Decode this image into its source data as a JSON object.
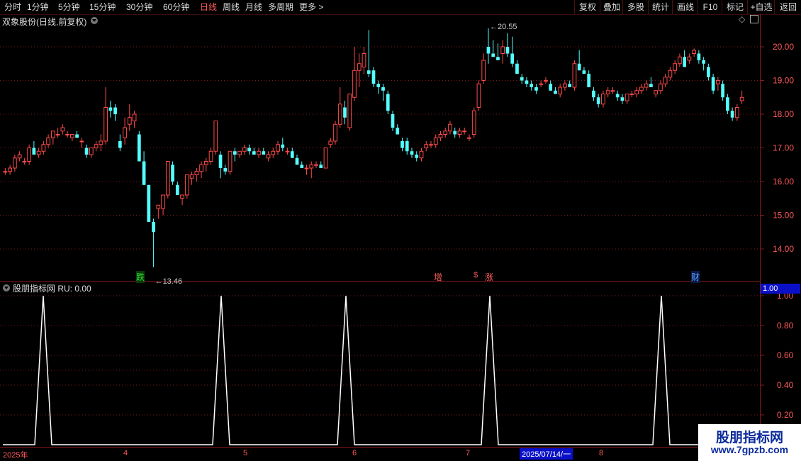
{
  "toolbar": {
    "periods": [
      "分时",
      "1分钟",
      "5分钟",
      "15分钟",
      "30分钟",
      "60分钟",
      "日线",
      "周线",
      "月线",
      "多周期",
      "更多 >"
    ],
    "active_period": "日线",
    "tools": [
      "复权",
      "叠加",
      "多股",
      "统计",
      "画线",
      "F10",
      "标记",
      "+自选",
      "返回"
    ]
  },
  "main_chart": {
    "title": "双象股份(日线,前复权)",
    "y_ticks": [
      "20.00",
      "19.00",
      "18.00",
      "17.00",
      "16.00",
      "15.00",
      "14.00"
    ],
    "y_values": [
      20,
      19,
      18,
      17,
      16,
      15,
      14
    ],
    "high_label": "20.55",
    "low_label": "13.46",
    "markers": [
      {
        "text": "跌",
        "color": "#33dd33"
      },
      {
        "text": "增",
        "color": "#ff5a5a"
      },
      {
        "text": "$",
        "color": "#ff5a5a"
      },
      {
        "text": "涨",
        "color": "#ff5a5a"
      },
      {
        "text": "财",
        "color": "#5aa0ff"
      }
    ]
  },
  "indicator": {
    "title": "股朋指标网 RU: 0.00",
    "current_value": "1.00",
    "y_ticks": [
      "1.00",
      "0.80",
      "0.60",
      "0.40",
      "0.20"
    ],
    "y_values": [
      1.0,
      0.8,
      0.6,
      0.4,
      0.2
    ]
  },
  "date_axis": {
    "labels": [
      "2025年",
      "4",
      "5",
      "6",
      "7",
      "8"
    ],
    "selected_date": "2025/07/14/一"
  },
  "watermark": {
    "line1": "股朋指标网",
    "line2": "www.7gpzb.com"
  },
  "colors": {
    "up": "#ff4a4a",
    "down": "#54ffff",
    "grid": "#7a1a1a",
    "axis": "#8a1a1a",
    "indicator_line": "#ffffff"
  },
  "chart_data": [
    {
      "type": "candlestick",
      "title": "双象股份(日线,前复权)",
      "ylim": [
        13.4,
        20.6
      ],
      "ohlc": [
        [
          16.3,
          16.4,
          16.2,
          16.3
        ],
        [
          16.3,
          16.5,
          16.2,
          16.4
        ],
        [
          16.4,
          16.8,
          16.3,
          16.7
        ],
        [
          16.7,
          16.9,
          16.6,
          16.8
        ],
        [
          16.6,
          16.7,
          16.5,
          16.6
        ],
        [
          16.6,
          17.1,
          16.5,
          17.0
        ],
        [
          17.0,
          17.2,
          16.9,
          16.8
        ],
        [
          16.8,
          17.0,
          16.7,
          16.9
        ],
        [
          16.9,
          17.2,
          16.8,
          17.1
        ],
        [
          17.1,
          17.4,
          17.0,
          17.3
        ],
        [
          17.3,
          17.5,
          17.1,
          17.5
        ],
        [
          17.4,
          17.6,
          17.3,
          17.4
        ],
        [
          17.5,
          17.7,
          17.4,
          17.6
        ],
        [
          17.4,
          17.5,
          17.3,
          17.4
        ],
        [
          17.3,
          17.4,
          17.2,
          17.4
        ],
        [
          17.4,
          17.5,
          17.3,
          17.3
        ],
        [
          17.2,
          17.3,
          17.0,
          17.2
        ],
        [
          17.0,
          17.1,
          16.7,
          16.8
        ],
        [
          16.8,
          17.0,
          16.7,
          17.0
        ],
        [
          17.0,
          17.2,
          16.9,
          17.1
        ],
        [
          17.1,
          17.4,
          16.9,
          17.2
        ],
        [
          17.2,
          18.8,
          17.1,
          18.2
        ],
        [
          18.2,
          18.4,
          17.9,
          18.1
        ],
        [
          18.2,
          18.3,
          17.8,
          18.0
        ],
        [
          17.2,
          17.4,
          16.9,
          17.0
        ],
        [
          17.3,
          17.9,
          17.1,
          17.6
        ],
        [
          17.7,
          18.3,
          17.5,
          17.9
        ],
        [
          17.8,
          18.1,
          17.6,
          18.0
        ],
        [
          17.4,
          17.5,
          16.9,
          16.6
        ],
        [
          16.6,
          16.9,
          15.9,
          15.9
        ],
        [
          15.9,
          15.9,
          14.8,
          14.8
        ],
        [
          14.8,
          14.9,
          13.46,
          14.5
        ],
        [
          15.2,
          15.2,
          14.9,
          15.3
        ],
        [
          15.2,
          15.5,
          15.0,
          15.6
        ],
        [
          15.6,
          16.6,
          15.5,
          16.6
        ],
        [
          16.5,
          16.6,
          15.9,
          16.0
        ],
        [
          15.9,
          16.0,
          15.6,
          15.6
        ],
        [
          15.5,
          15.6,
          15.3,
          15.6
        ],
        [
          15.6,
          16.2,
          15.5,
          16.2
        ],
        [
          16.1,
          16.3,
          15.9,
          16.2
        ],
        [
          16.2,
          16.4,
          16.0,
          16.3
        ],
        [
          16.3,
          16.6,
          16.1,
          16.5
        ],
        [
          16.5,
          16.7,
          16.3,
          16.6
        ],
        [
          16.6,
          17.0,
          16.5,
          16.9
        ],
        [
          16.9,
          17.8,
          16.8,
          17.8
        ],
        [
          16.8,
          16.9,
          16.1,
          16.4
        ],
        [
          16.4,
          16.5,
          16.2,
          16.3
        ],
        [
          16.3,
          16.9,
          16.2,
          16.9
        ],
        [
          16.9,
          17.0,
          16.6,
          16.8
        ],
        [
          16.8,
          16.9,
          16.7,
          16.9
        ],
        [
          16.9,
          17.1,
          16.8,
          17.0
        ],
        [
          17.0,
          17.1,
          16.8,
          16.9
        ],
        [
          16.9,
          17.0,
          16.8,
          16.8
        ],
        [
          16.8,
          17.0,
          16.7,
          16.9
        ],
        [
          16.9,
          17.0,
          16.8,
          16.8
        ],
        [
          16.7,
          16.9,
          16.6,
          16.8
        ],
        [
          16.8,
          17.0,
          16.7,
          16.9
        ],
        [
          16.9,
          17.2,
          16.8,
          17.1
        ],
        [
          17.1,
          17.3,
          16.9,
          17.0
        ],
        [
          16.9,
          17.0,
          16.8,
          16.9
        ],
        [
          16.9,
          17.0,
          16.7,
          16.7
        ],
        [
          16.7,
          16.8,
          16.5,
          16.5
        ],
        [
          16.5,
          16.6,
          16.4,
          16.4
        ],
        [
          16.4,
          16.5,
          16.2,
          16.4
        ],
        [
          16.4,
          16.6,
          16.1,
          16.5
        ],
        [
          16.5,
          16.6,
          16.4,
          16.5
        ],
        [
          16.5,
          16.6,
          16.4,
          16.4
        ],
        [
          16.4,
          17.0,
          16.4,
          17.0
        ],
        [
          17.1,
          17.3,
          17.0,
          17.2
        ],
        [
          17.2,
          17.8,
          17.1,
          17.7
        ],
        [
          17.7,
          18.8,
          17.6,
          18.3
        ],
        [
          18.2,
          18.4,
          17.7,
          17.9
        ],
        [
          17.6,
          18.6,
          17.5,
          18.6
        ],
        [
          18.5,
          20.0,
          18.4,
          19.3
        ],
        [
          19.3,
          19.8,
          18.8,
          19.5
        ],
        [
          19.4,
          20.0,
          19.2,
          19.8
        ],
        [
          19.3,
          20.5,
          19.1,
          19.2
        ],
        [
          19.3,
          19.4,
          18.8,
          18.9
        ],
        [
          18.9,
          19.0,
          18.6,
          18.8
        ],
        [
          18.8,
          18.9,
          18.4,
          18.7
        ],
        [
          18.6,
          18.7,
          18.0,
          18.1
        ],
        [
          18.0,
          18.1,
          17.5,
          17.6
        ],
        [
          17.6,
          17.7,
          17.4,
          17.4
        ],
        [
          17.2,
          17.3,
          16.9,
          17.0
        ],
        [
          17.2,
          17.3,
          16.8,
          16.9
        ],
        [
          16.9,
          17.0,
          16.7,
          16.8
        ],
        [
          16.8,
          16.9,
          16.6,
          16.7
        ],
        [
          16.7,
          17.0,
          16.6,
          16.9
        ],
        [
          17.0,
          17.2,
          16.9,
          17.1
        ],
        [
          17.1,
          17.2,
          17.0,
          17.1
        ],
        [
          17.1,
          17.4,
          17.0,
          17.3
        ],
        [
          17.3,
          17.5,
          17.2,
          17.4
        ],
        [
          17.4,
          17.6,
          17.3,
          17.5
        ],
        [
          17.5,
          17.8,
          17.4,
          17.7
        ],
        [
          17.5,
          17.6,
          17.3,
          17.4
        ],
        [
          17.4,
          17.6,
          17.3,
          17.5
        ],
        [
          17.5,
          17.6,
          17.4,
          17.5
        ],
        [
          17.3,
          17.4,
          17.2,
          17.3
        ],
        [
          17.4,
          18.2,
          17.3,
          18.1
        ],
        [
          18.2,
          19.0,
          18.1,
          18.9
        ],
        [
          19.0,
          19.8,
          18.9,
          19.6
        ],
        [
          20.0,
          20.55,
          19.5,
          19.8
        ],
        [
          19.8,
          20.2,
          19.7,
          19.7
        ],
        [
          19.7,
          20.1,
          19.6,
          19.6
        ],
        [
          19.8,
          20.2,
          19.5,
          20.0
        ],
        [
          20.0,
          20.4,
          19.7,
          19.8
        ],
        [
          19.8,
          20.3,
          19.4,
          19.5
        ],
        [
          19.5,
          19.6,
          19.2,
          19.2
        ],
        [
          19.1,
          19.2,
          18.9,
          19.0
        ],
        [
          19.0,
          19.1,
          18.8,
          18.9
        ],
        [
          18.9,
          19.0,
          18.7,
          18.8
        ],
        [
          18.8,
          18.9,
          18.6,
          18.7
        ],
        [
          18.9,
          19.0,
          18.8,
          18.9
        ],
        [
          19.0,
          19.1,
          18.9,
          19.0
        ],
        [
          18.9,
          19.0,
          18.7,
          18.7
        ],
        [
          18.7,
          18.8,
          18.6,
          18.6
        ],
        [
          18.6,
          18.9,
          18.5,
          18.8
        ],
        [
          18.8,
          19.0,
          18.7,
          18.9
        ],
        [
          18.9,
          19.0,
          18.8,
          18.8
        ],
        [
          18.8,
          19.6,
          18.7,
          19.5
        ],
        [
          19.5,
          19.9,
          19.4,
          19.3
        ],
        [
          19.3,
          19.4,
          19.2,
          19.2
        ],
        [
          19.2,
          19.3,
          19.0,
          18.8
        ],
        [
          18.7,
          18.8,
          18.4,
          18.5
        ],
        [
          18.5,
          18.6,
          18.2,
          18.3
        ],
        [
          18.3,
          18.7,
          18.2,
          18.6
        ],
        [
          18.6,
          18.8,
          18.5,
          18.7
        ],
        [
          18.7,
          18.8,
          18.6,
          18.7
        ],
        [
          18.6,
          18.7,
          18.4,
          18.5
        ],
        [
          18.5,
          18.6,
          18.3,
          18.4
        ],
        [
          18.4,
          18.5,
          18.3,
          18.6
        ],
        [
          18.6,
          18.7,
          18.5,
          18.6
        ],
        [
          18.6,
          18.8,
          18.5,
          18.7
        ],
        [
          18.7,
          18.9,
          18.6,
          18.8
        ],
        [
          18.8,
          19.0,
          18.7,
          18.9
        ],
        [
          18.9,
          19.1,
          18.8,
          18.8
        ],
        [
          18.6,
          18.7,
          18.5,
          18.7
        ],
        [
          18.7,
          19.0,
          18.6,
          18.9
        ],
        [
          18.9,
          19.2,
          18.8,
          19.1
        ],
        [
          19.1,
          19.4,
          19.0,
          19.3
        ],
        [
          19.3,
          19.6,
          19.2,
          19.5
        ],
        [
          19.5,
          19.8,
          19.4,
          19.7
        ],
        [
          19.7,
          19.9,
          19.6,
          19.4
        ],
        [
          19.6,
          19.8,
          19.5,
          19.7
        ],
        [
          19.8,
          19.95,
          19.7,
          19.9
        ],
        [
          19.8,
          19.9,
          19.5,
          19.6
        ],
        [
          19.6,
          19.7,
          19.3,
          19.5
        ],
        [
          19.4,
          19.5,
          19.0,
          19.1
        ],
        [
          19.1,
          19.2,
          18.6,
          18.7
        ],
        [
          18.9,
          19.1,
          18.7,
          19.0
        ],
        [
          18.9,
          19.0,
          18.4,
          18.5
        ],
        [
          18.5,
          18.6,
          18.0,
          18.1
        ],
        [
          18.1,
          18.2,
          17.8,
          17.9
        ],
        [
          17.9,
          18.3,
          17.8,
          18.2
        ],
        [
          18.4,
          18.7,
          18.3,
          18.5
        ]
      ]
    },
    {
      "type": "line",
      "series": [
        {
          "name": "RU",
          "values": [
            0,
            0,
            0,
            0,
            0,
            0,
            0,
            0,
            0,
            0,
            0,
            0,
            0,
            0,
            0,
            0,
            0,
            0,
            0,
            0,
            0,
            0,
            0,
            0,
            0,
            0,
            0,
            0,
            0,
            0,
            0,
            0,
            1,
            0,
            0,
            0,
            0,
            0,
            0,
            0,
            0,
            0,
            0,
            0,
            0,
            0,
            0,
            0,
            0,
            0,
            0,
            0,
            0,
            0,
            0,
            0,
            0,
            0,
            0,
            0,
            0,
            0,
            0,
            0,
            0,
            0,
            0,
            0,
            0,
            0,
            0,
            0,
            0,
            0,
            0,
            0,
            0,
            0,
            0,
            0,
            0,
            0,
            0,
            0,
            0,
            0,
            0,
            0,
            0,
            0,
            0,
            0,
            0,
            0,
            0,
            0,
            0,
            0,
            0,
            0,
            0,
            0,
            0,
            0,
            0,
            0,
            0,
            0,
            0,
            0,
            0,
            0,
            0,
            0,
            0,
            0,
            0,
            0,
            0,
            0,
            0,
            0,
            0,
            0,
            0,
            0,
            0,
            0,
            0,
            0,
            0,
            0,
            0,
            0,
            0,
            0,
            0,
            0,
            0,
            0,
            0,
            0,
            0,
            0,
            0,
            0,
            0,
            0,
            0,
            0,
            0,
            0,
            0,
            0,
            0,
            0,
            0,
            0,
            0,
            0,
            0,
            0,
            0,
            0
          ]
        }
      ],
      "peaks_at_dates": [
        "2025-01-08",
        "2025-04-07",
        "2025-05-30",
        "2025-07-14",
        "2025-09-03"
      ],
      "ylim": [
        0,
        1.05
      ]
    }
  ]
}
